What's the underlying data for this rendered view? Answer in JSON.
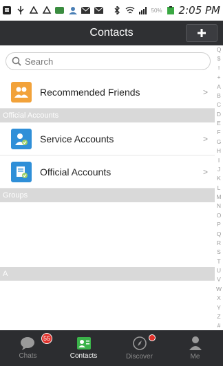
{
  "status_bar": {
    "battery_percent": "50%",
    "time": "2:05 PM",
    "icons": [
      "notification-icon",
      "usb-icon",
      "recycle-icon",
      "recycle-icon",
      "app-icon",
      "user-icon",
      "email-icon",
      "email-icon",
      "bluetooth-icon",
      "wifi-icon",
      "signal-icon",
      "battery-icon"
    ]
  },
  "header": {
    "title": "Contacts",
    "add_button_icon": "plus-icon"
  },
  "search": {
    "placeholder": "Search",
    "value": ""
  },
  "top_items": [
    {
      "label": "Recommended Friends",
      "icon": "recommended-friends-icon",
      "color": "#f2a23a"
    }
  ],
  "official_section": {
    "header": "Official Accounts",
    "items": [
      {
        "label": "Service Accounts",
        "icon": "service-accounts-icon",
        "color": "#2f8fd8"
      },
      {
        "label": "Official Accounts",
        "icon": "official-accounts-icon",
        "color": "#2f8fd8"
      }
    ]
  },
  "groups_section": {
    "header": "Groups"
  },
  "a_section": {
    "header": "A"
  },
  "index_bar": [
    "Q",
    "$",
    "!",
    "+",
    "A",
    "B",
    "C",
    "D",
    "E",
    "F",
    "G",
    "H",
    "I",
    "J",
    "K",
    "L",
    "M",
    "N",
    "O",
    "P",
    "Q",
    "R",
    "S",
    "T",
    "U",
    "V",
    "W",
    "X",
    "Y",
    "Z",
    "#"
  ],
  "tabs": [
    {
      "label": "Chats",
      "icon": "chat-bubble-icon",
      "badge": "55",
      "active": false
    },
    {
      "label": "Contacts",
      "icon": "contacts-card-icon",
      "active": true
    },
    {
      "label": "Discover",
      "icon": "compass-icon",
      "dot": true,
      "active": false
    },
    {
      "label": "Me",
      "icon": "person-icon",
      "active": false
    }
  ],
  "colors": {
    "header_bg": "#2f3033",
    "tabbar_bg": "#2c2d30",
    "active_tab": "#3bb34a",
    "badge": "#e0312b"
  }
}
